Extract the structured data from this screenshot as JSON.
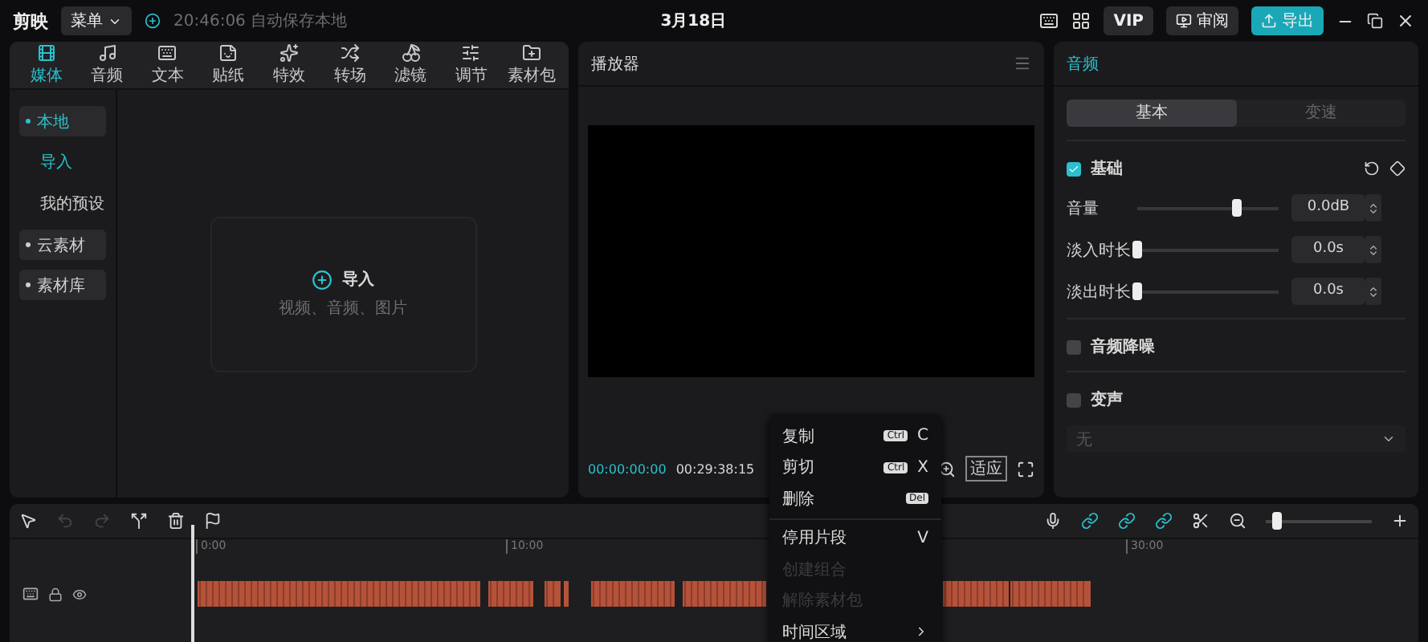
{
  "app": {
    "name": "剪映",
    "menu": "菜单",
    "autosave": "20:46:06 自动保存本地",
    "title": "3月18日",
    "vip": "VIP",
    "review": "审阅",
    "export": "导出"
  },
  "media_tabs": [
    {
      "label": "媒体",
      "kind": "media",
      "selected": true
    },
    {
      "label": "音频",
      "kind": "audio",
      "selected": false
    },
    {
      "label": "文本",
      "kind": "text",
      "selected": false
    },
    {
      "label": "贴纸",
      "kind": "sticker",
      "selected": false
    },
    {
      "label": "特效",
      "kind": "effect",
      "selected": false
    },
    {
      "label": "转场",
      "kind": "transition",
      "selected": false
    },
    {
      "label": "滤镜",
      "kind": "filter",
      "selected": false
    },
    {
      "label": "调节",
      "kind": "adjust",
      "selected": false
    },
    {
      "label": "素材包",
      "kind": "pack",
      "selected": false
    }
  ],
  "sidebar": [
    {
      "label": "本地",
      "selected": true,
      "children": [
        {
          "label": "导入",
          "selected": true
        },
        {
          "label": "我的预设",
          "selected": false
        }
      ]
    },
    {
      "label": "云素材",
      "selected": false
    },
    {
      "label": "素材库",
      "selected": false
    }
  ],
  "import": {
    "label": "导入",
    "hint": "视频、音频、图片"
  },
  "player": {
    "title": "播放器",
    "current_time": "00:00:00:00",
    "duration": "00:29:38:15",
    "fit": "适应"
  },
  "inspector": {
    "title": "音频",
    "tabs": [
      {
        "label": "基本",
        "selected": true
      },
      {
        "label": "变速",
        "selected": false
      }
    ],
    "sections": [
      {
        "label": "基础",
        "checked": true,
        "rows": [
          {
            "label": "音量",
            "level": 0.7,
            "value": "0.0dB"
          },
          {
            "label": "淡入时长",
            "level": 0,
            "value": "0.0s"
          },
          {
            "label": "淡出时长",
            "level": 0,
            "value": "0.0s"
          }
        ]
      },
      {
        "label": "音频降噪",
        "checked": false
      },
      {
        "label": "变声",
        "checked": false,
        "select": "无"
      }
    ]
  },
  "timeline": {
    "ticks": [
      "0:00",
      "10:00",
      "30:00"
    ],
    "zoom": {
      "level": 0.1
    }
  },
  "context_menu": [
    {
      "label": "复制",
      "keys": [
        "Ctrl",
        "C"
      ],
      "disabled": false
    },
    {
      "label": "剪切",
      "keys": [
        "Ctrl",
        "X"
      ],
      "disabled": false
    },
    {
      "label": "删除",
      "keys": [
        "Del"
      ],
      "disabled": false
    },
    {
      "label": "停用片段",
      "keys": [
        "V"
      ],
      "disabled": false
    },
    {
      "label": "创建组合",
      "disabled": true
    },
    {
      "label": "解除素材包",
      "disabled": true
    },
    {
      "label": "时间区域",
      "submenu": true,
      "disabled": false
    }
  ]
}
